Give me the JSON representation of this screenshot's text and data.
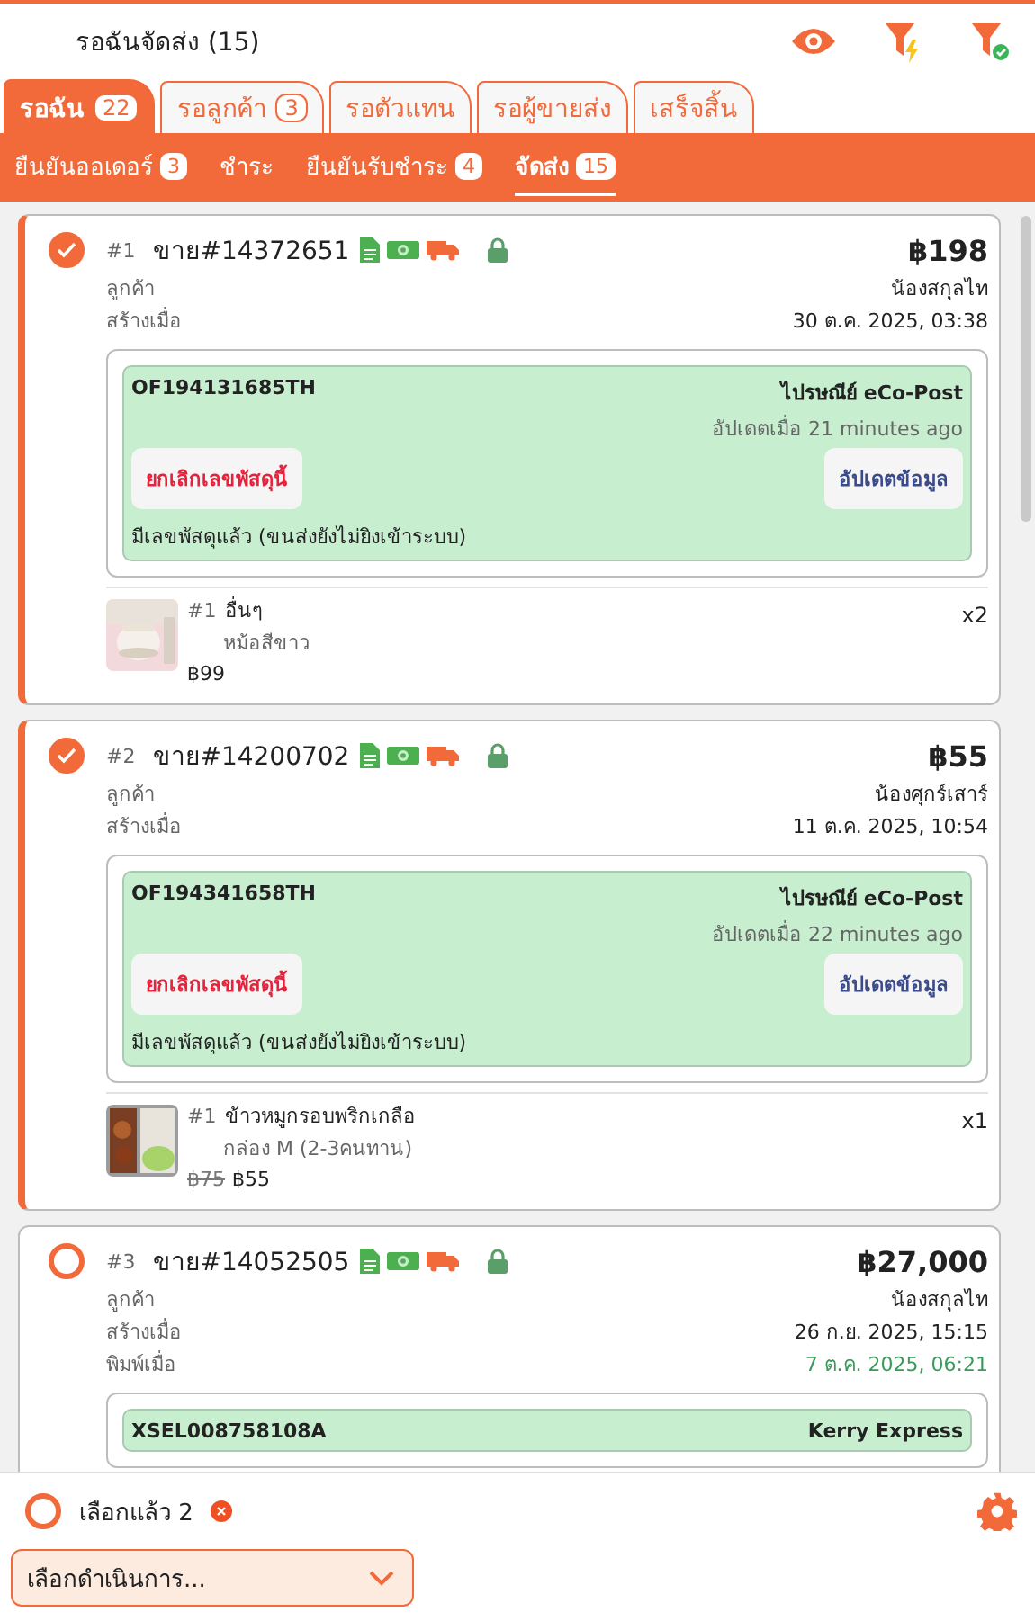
{
  "header": {
    "title": "รอฉันจัดส่ง (15)"
  },
  "tabs": [
    {
      "label": "รอฉัน",
      "count": "22",
      "selected": true
    },
    {
      "label": "รอลูกค้า",
      "count": "3",
      "selected": false
    },
    {
      "label": "รอตัวแทน",
      "selected": false
    },
    {
      "label": "รอผู้ขายส่ง",
      "selected": false
    },
    {
      "label": "เสร็จสิ้น",
      "selected": false
    }
  ],
  "subtabs": [
    {
      "label": "ยืนยันออเดอร์",
      "count": "3",
      "selected": false
    },
    {
      "label": "ชำระ",
      "selected": false
    },
    {
      "label": "ยืนยันรับชำระ",
      "count": "4",
      "selected": false
    },
    {
      "label": "จัดส่ง",
      "count": "15",
      "selected": true
    }
  ],
  "orders": [
    {
      "selected": true,
      "index": "#1",
      "number": "ขาย#14372651",
      "total": "฿198",
      "fields": [
        {
          "label": "ลูกค้า",
          "value": "น้องสกุลไท",
          "kind": "plain"
        },
        {
          "label": "สร้างเมื่อ",
          "value": "30 ต.ค. 2025, 03:38",
          "kind": "plain"
        }
      ],
      "shipment": {
        "tracking": "OF194131685TH",
        "carrier": "ไปรษณีย์ eCo-Post",
        "updated": "อัปเดตเมื่อ 21 minutes ago",
        "cancel_label": "ยกเลิกเลขพัสดุนี้",
        "update_label": "อัปเดตข้อมูล",
        "status": "มีเลขพัสดุแล้ว (ขนส่งยังไม่ยิงเข้าระบบ)"
      },
      "items": [
        {
          "index": "#1",
          "name": "อื่นๆ",
          "variant": "หม้อสีขาว",
          "price": "฿99",
          "qty": "x2"
        }
      ]
    },
    {
      "selected": true,
      "index": "#2",
      "number": "ขาย#14200702",
      "total": "฿55",
      "fields": [
        {
          "label": "ลูกค้า",
          "value": "น้องศุกร์เสาร์",
          "kind": "plain"
        },
        {
          "label": "สร้างเมื่อ",
          "value": "11 ต.ค. 2025, 10:54",
          "kind": "plain"
        }
      ],
      "shipment": {
        "tracking": "OF194341658TH",
        "carrier": "ไปรษณีย์ eCo-Post",
        "updated": "อัปเดตเมื่อ 22 minutes ago",
        "cancel_label": "ยกเลิกเลขพัสดุนี้",
        "update_label": "อัปเดตข้อมูล",
        "status": "มีเลขพัสดุแล้ว (ขนส่งยังไม่ยิงเข้าระบบ)"
      },
      "items": [
        {
          "index": "#1",
          "name": "ข้าวหมูกรอบพริกเกลือ",
          "variant": "กล่อง M (2-3คนทาน)",
          "old_price": "฿75",
          "price": "฿55",
          "qty": "x1"
        }
      ]
    },
    {
      "selected": false,
      "index": "#3",
      "number": "ขาย#14052505",
      "total": "฿27,000",
      "fields": [
        {
          "label": "ลูกค้า",
          "value": "น้องสกุลไท",
          "kind": "plain"
        },
        {
          "label": "สร้างเมื่อ",
          "value": "26 ก.ย. 2025, 15:15",
          "kind": "plain"
        },
        {
          "label": "พิมพ์เมื่อ",
          "value": "7 ต.ค. 2025, 06:21",
          "kind": "printed"
        }
      ],
      "shipment": {
        "tracking": "XSEL008758108A",
        "carrier": "Kerry Express"
      }
    }
  ],
  "footer": {
    "all_selected": false,
    "selected_label": "เลือกแล้ว 2",
    "action": {
      "placeholder": "เลือกดำเนินการ..."
    }
  }
}
